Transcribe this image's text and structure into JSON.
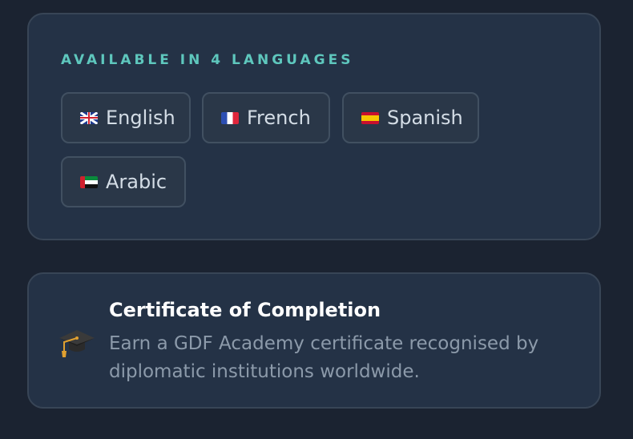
{
  "languages": {
    "heading": "AVAILABLE IN 4 LANGUAGES",
    "items": [
      {
        "label": "English",
        "flag": "uk-flag-icon"
      },
      {
        "label": "French",
        "flag": "france-flag-icon"
      },
      {
        "label": "Spanish",
        "flag": "spain-flag-icon"
      },
      {
        "label": "Arabic",
        "flag": "uae-flag-icon"
      }
    ]
  },
  "certificate": {
    "icon": "graduation-cap-icon",
    "title": "Certificate of Completion",
    "description": "Earn a GDF Academy certificate recognised by diplomatic institutions worldwide."
  },
  "colors": {
    "background": "#1b2331",
    "card": "#243246",
    "accent": "#5ec7bd"
  }
}
